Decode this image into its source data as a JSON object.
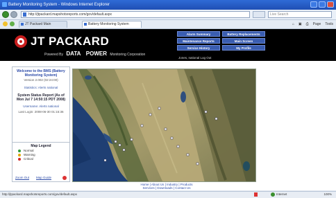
{
  "window": {
    "title": "Battery Monitoring System - Windows Internet Explorer"
  },
  "browser": {
    "address": "http://jtpackard.mapshotsreports.com/gov/default.aspx",
    "search_placeholder": "Live Search",
    "tabs": [
      {
        "label": "JT Packard Main"
      },
      {
        "label": "Battery Monitoring System"
      }
    ],
    "toolbar_items": [
      "Page",
      "Tools"
    ]
  },
  "header": {
    "brand": "JT PACKARD",
    "powered_by": "Powered By",
    "partner_name": "DATA",
    "partner_name2": "POWER",
    "partner_suffix": "Monitoring Corporation",
    "welcome_user": "Jones, national Log Out",
    "nav": [
      {
        "label": "Alarm Summary"
      },
      {
        "label": "Battery Replacements"
      },
      {
        "label": "Maintenance Reports"
      },
      {
        "label": "Main Screen"
      },
      {
        "label": "Service History"
      },
      {
        "label": "My Profile"
      }
    ]
  },
  "sidebar": {
    "welcome_title": "Welcome to the BMS (Battery Monitoring System)",
    "version": "Version 2.002 (02:24:00)",
    "status_line": "Statistics: Alerts national",
    "report_title": "System Status Report (As of Mon Jul 7 14:50:15 PDT 2008)",
    "user_line": "Username: Alerts national",
    "last_login": "Last Login: 2008-06-30 01:15:36"
  },
  "legend": {
    "title": "Map Legend",
    "items": [
      {
        "label": "Normal",
        "color": "#2e9b3a"
      },
      {
        "label": "Warning",
        "color": "#e0a800"
      },
      {
        "label": "Critical",
        "color": "#d02a2a"
      }
    ],
    "link_reset": "Zoom Out",
    "link_help": "Map Guide"
  },
  "footer": {
    "line1": "Home | About Us | Industry | Products",
    "line2": "Services | Downloads | Contact Us"
  },
  "status": {
    "url": "http://jtpackard.mapshotsreports.com/gov/default.aspx",
    "zone": "Internet",
    "zoom": "100%"
  }
}
